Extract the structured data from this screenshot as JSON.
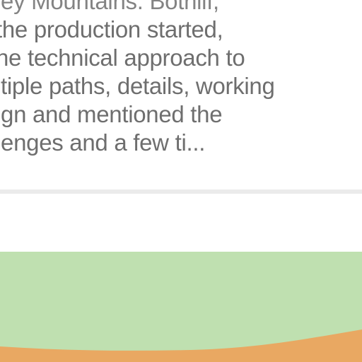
{
  "article": {
    "excerpt_lines": [
      "ley Mountains. Bothilf,",
      "the production started,",
      "ne technical approach to",
      "ltiple paths, details, working",
      "ign and mentioned the",
      "lenges and a few ti..."
    ]
  },
  "thumbnail": {
    "colors": {
      "sky": "#bfe0b0",
      "ground": "#e9a862",
      "divider": "#ebebeb",
      "text": "#6e6e6e"
    }
  }
}
